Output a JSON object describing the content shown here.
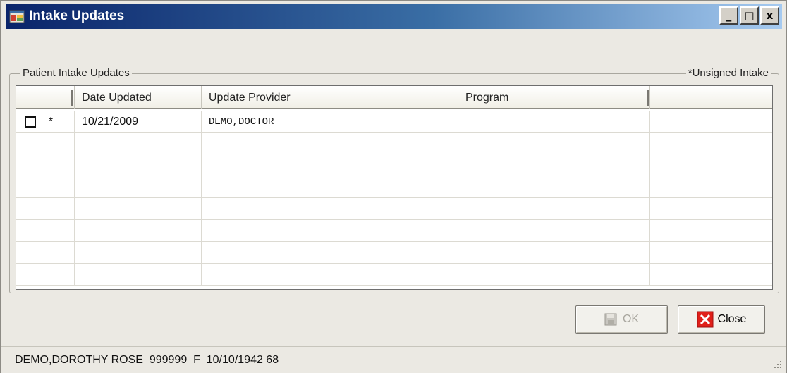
{
  "window": {
    "title": "Intake Updates",
    "controls": {
      "minimize": "_",
      "maximize": "□",
      "close": "x"
    }
  },
  "group": {
    "label": "Patient Intake Updates",
    "note": "*Unsigned Intake"
  },
  "grid": {
    "columns": [
      "",
      "",
      "Date Updated",
      "Update Provider",
      "Program",
      ""
    ],
    "rows": [
      {
        "checked": false,
        "marker": "*",
        "date_updated": "10/21/2009",
        "update_provider": "DEMO,DOCTOR",
        "program": ""
      }
    ],
    "empty_rows": 7
  },
  "buttons": {
    "ok_label": "OK",
    "close_label": "Close"
  },
  "status": {
    "patient_info": "DEMO,DOROTHY ROSE  999999  F  10/10/1942 68"
  },
  "colors": {
    "title_bar_start": "#0a246a",
    "title_bar_end": "#a6caf0",
    "close_icon": "#e0201a"
  }
}
